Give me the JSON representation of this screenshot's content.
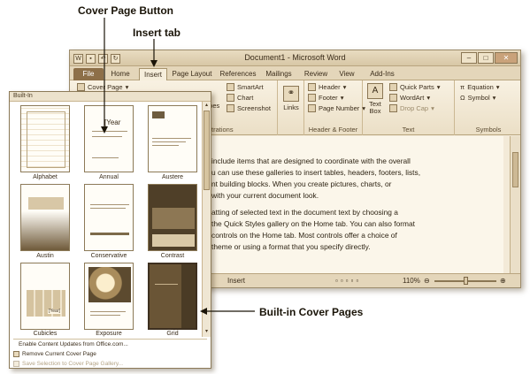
{
  "callouts": {
    "cover_page_button": "Cover Page Button",
    "insert_tab": "Insert tab",
    "builtin_cover_pages": "Built-in Cover Pages"
  },
  "window": {
    "title": "Document1 - Microsoft Word",
    "qat_icons": [
      "word-icon",
      "save-icon",
      "undo-icon",
      "redo-icon"
    ],
    "controls": [
      "minimize",
      "maximize",
      "close"
    ]
  },
  "tabs": [
    {
      "label": "File"
    },
    {
      "label": "Home"
    },
    {
      "label": "Insert"
    },
    {
      "label": "Page Layout"
    },
    {
      "label": "References"
    },
    {
      "label": "Mailings"
    },
    {
      "label": "Review"
    },
    {
      "label": "View"
    },
    {
      "label": "Add-Ins"
    }
  ],
  "ribbon": {
    "cover_page": "Cover Page",
    "illustrations": {
      "shapes": "apes",
      "smartart": "SmartArt",
      "chart": "Chart",
      "screenshot": "Screenshot",
      "label": "trations"
    },
    "links": {
      "label": "Links"
    },
    "header_footer": {
      "header": "Header",
      "footer": "Footer",
      "page_number": "Page Number",
      "label": "Header & Footer"
    },
    "text": {
      "text_box": "Text Box",
      "quick_parts": "Quick Parts",
      "wordart": "WordArt",
      "drop_cap": "Drop Cap",
      "label": "Text"
    },
    "symbols": {
      "equation": "Equation",
      "symbol": "Symbol",
      "label": "Symbols"
    }
  },
  "document": {
    "lines": [
      "include items that are designed to coordinate with the overall",
      "u can use these galleries to insert tables, headers, footers, lists,",
      "nt building blocks. When you create pictures, charts, or",
      "with your current document look.",
      "atting of selected text in the document text by choosing a",
      "the Quick Styles gallery on the Home tab. You can also format",
      "controls on the Home tab. Most controls offer a choice of",
      "theme or using a format that you specify directly."
    ]
  },
  "statusbar": {
    "insert_mode": "Insert",
    "zoom": "110%",
    "zoom_level_percent": 110
  },
  "gallery": {
    "header": "Built-In",
    "covers": [
      {
        "name": "Alphabet"
      },
      {
        "name": "Annual",
        "year_placeholder": "[Year"
      },
      {
        "name": "Austere"
      },
      {
        "name": "Austin"
      },
      {
        "name": "Conservative"
      },
      {
        "name": "Contrast"
      },
      {
        "name": "Cubicles",
        "year_placeholder": "[Year]"
      },
      {
        "name": "Exposure"
      },
      {
        "name": "Grid"
      }
    ],
    "menu": {
      "enable_updates": "Enable Content Updates from Office.com...",
      "remove_cover": "Remove Current Cover Page",
      "save_selection": "Save Selection to Cover Page Gallery..."
    }
  }
}
